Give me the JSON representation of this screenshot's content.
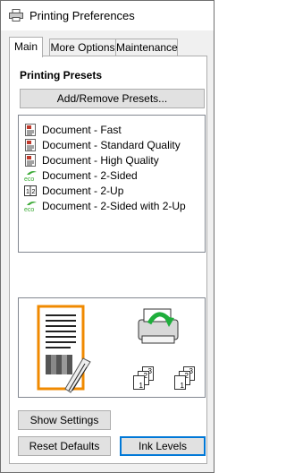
{
  "window": {
    "title": "Printing Preferences"
  },
  "tabs": [
    {
      "label": "Main",
      "active": true
    },
    {
      "label": "More Options",
      "active": false
    },
    {
      "label": "Maintenance",
      "active": false
    }
  ],
  "main": {
    "section_title": "Printing Presets",
    "add_remove_label": "Add/Remove Presets...",
    "presets": [
      {
        "label": "Document - Fast",
        "icon": "document-icon"
      },
      {
        "label": "Document - Standard Quality",
        "icon": "document-icon"
      },
      {
        "label": "Document - High Quality",
        "icon": "document-icon"
      },
      {
        "label": "Document - 2-Sided",
        "icon": "eco-icon"
      },
      {
        "label": "Document - 2-Up",
        "icon": "two-up-icon"
      },
      {
        "label": "Document - 2-Sided with 2-Up",
        "icon": "eco-icon"
      }
    ],
    "preview": {
      "collate_a": [
        "1",
        "2",
        "3"
      ],
      "collate_b": [
        "1",
        "2",
        "3"
      ]
    }
  },
  "buttons": {
    "show_settings": "Show Settings",
    "reset_defaults": "Reset Defaults",
    "ink_levels": "Ink Levels"
  },
  "icons": {
    "eco_text": "eco",
    "two_up_text": "1 2"
  },
  "colors": {
    "accent": "#0078d7",
    "eco_green": "#3aa935",
    "page_orange": "#f08a00",
    "arrow_green": "#1fae3c"
  }
}
